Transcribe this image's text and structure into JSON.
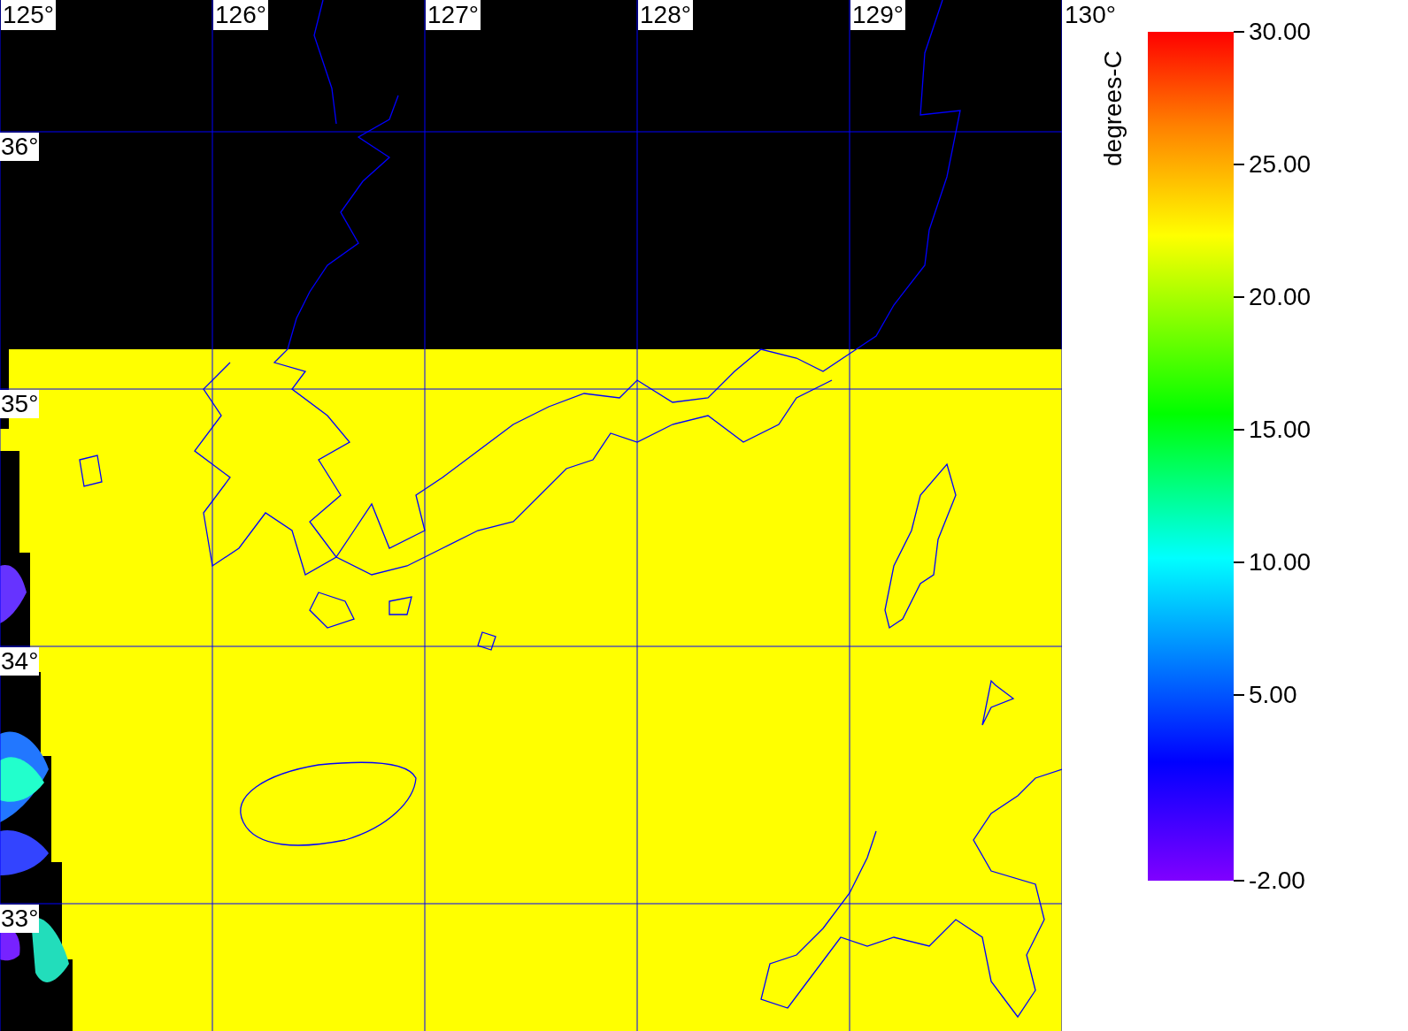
{
  "map": {
    "longitude_labels": [
      "125°",
      "126°",
      "127°",
      "128°",
      "129°",
      "130°"
    ],
    "latitude_labels": [
      "36°",
      "35°",
      "34°",
      "33°"
    ]
  },
  "legend": {
    "unit": "degrees-C",
    "ticks": [
      "30.00",
      "25.00",
      "20.00",
      "15.00",
      "10.00",
      "5.00",
      "-2.00"
    ]
  }
}
